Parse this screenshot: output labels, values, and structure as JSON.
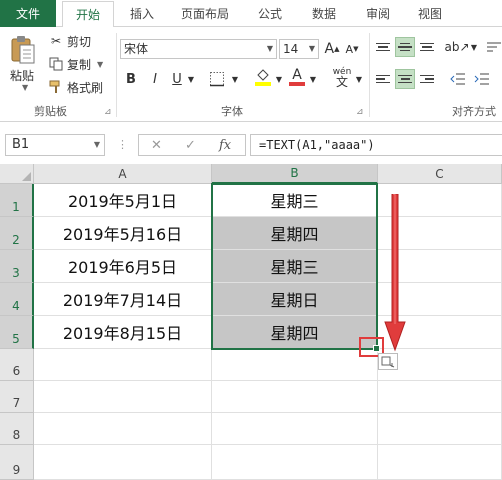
{
  "tabs": [
    "文件",
    "开始",
    "插入",
    "页面布局",
    "公式",
    "数据",
    "审阅",
    "视图"
  ],
  "active_tab": "开始",
  "clipboard": {
    "paste_label": "粘贴",
    "cut_label": "剪切",
    "copy_label": "复制",
    "format_painter_label": "格式刷",
    "group_label": "剪贴板"
  },
  "font": {
    "font_name": "宋体",
    "font_size": "14",
    "bold": "B",
    "italic": "I",
    "underline": "U",
    "grow": "A",
    "shrink": "A",
    "color_letter": "A",
    "phonetic": "wén",
    "group_label": "字体"
  },
  "alignment": {
    "group_label": "对齐方式"
  },
  "formula_bar": {
    "name_box": "B1",
    "cancel_icon": "✕",
    "enter_icon": "✓",
    "fx": "fx",
    "formula": "=TEXT(A1,\"aaaa\")"
  },
  "sheet": {
    "columns": [
      "A",
      "B",
      "C"
    ],
    "rows": [
      "1",
      "2",
      "3",
      "4",
      "5",
      "6",
      "7",
      "8",
      "9"
    ],
    "col_a": [
      "2019年5月1日",
      "2019年5月16日",
      "2019年6月5日",
      "2019年7月14日",
      "2019年8月15日"
    ],
    "col_b": [
      "星期三",
      "星期四",
      "星期三",
      "星期日",
      "星期四"
    ],
    "selected_cell": "B1"
  },
  "colors": {
    "accent": "#217346",
    "arrow_red": "#e03c3c",
    "selection_shade": "#c6c6c6"
  }
}
